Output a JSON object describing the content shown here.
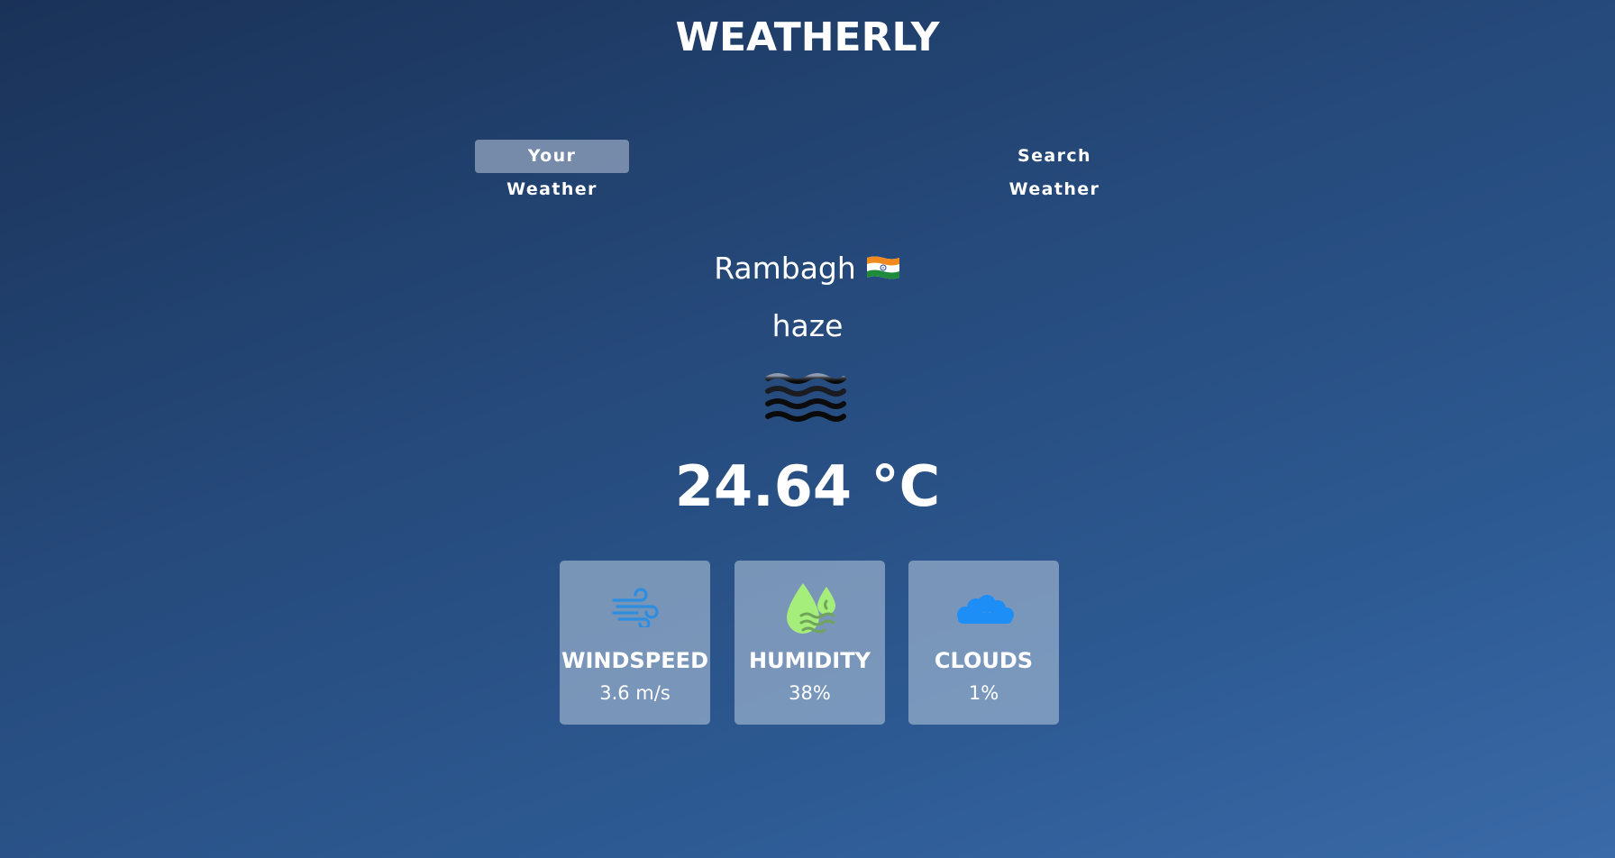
{
  "app": {
    "title": "WEATHERLY"
  },
  "tabs": [
    {
      "label": "Your Weather",
      "active": true
    },
    {
      "label": "Search Weather",
      "active": false
    }
  ],
  "weather": {
    "city": "Rambagh",
    "country_flag_icon": "india-flag-icon",
    "condition": "haze",
    "condition_icon": "haze-icon",
    "temperature": "24.64 °C"
  },
  "stats": [
    {
      "label": "WINDSPEED",
      "value": "3.6 m/s",
      "icon": "wind-icon",
      "color": "#2d8de0"
    },
    {
      "label": "HUMIDITY",
      "value": "38%",
      "icon": "humidity-drops-icon",
      "color": "#a6ee7c"
    },
    {
      "label": "CLOUDS",
      "value": "1%",
      "icon": "clouds-icon",
      "color": "#1e8ef7"
    }
  ]
}
